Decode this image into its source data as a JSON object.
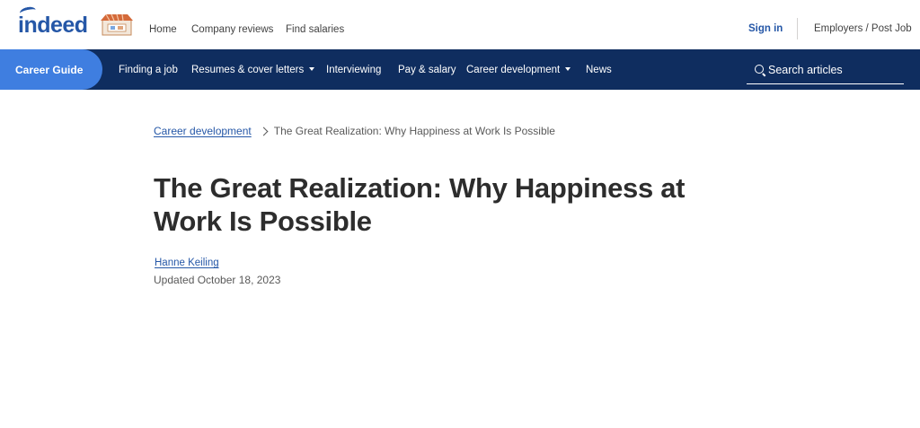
{
  "header": {
    "logo": "indeed",
    "nav": [
      "Home",
      "Company reviews",
      "Find salaries"
    ],
    "sign_in": "Sign in",
    "employers": "Employers / Post Job"
  },
  "navbar": {
    "guide_label": "Career Guide",
    "items": [
      {
        "label": "Finding a job"
      },
      {
        "label": "Resumes & cover letters"
      },
      {
        "label": "Interviewing"
      },
      {
        "label": "Pay & salary"
      },
      {
        "label": "Career development"
      },
      {
        "label": "News"
      }
    ],
    "search_placeholder": "Search articles"
  },
  "article": {
    "breadcrumb_parent": "Career development",
    "breadcrumb_current": "The Great Realization: Why Happiness at Work Is Possible",
    "title": "The Great Realization: Why Happiness at Work Is Possible",
    "author": "Hanne Keiling",
    "updated": "Updated October 18, 2023"
  },
  "colors": {
    "brand_blue": "#2557a7",
    "navbar_bg": "#0f2d5f",
    "guide_pill": "#3f7ee0"
  }
}
